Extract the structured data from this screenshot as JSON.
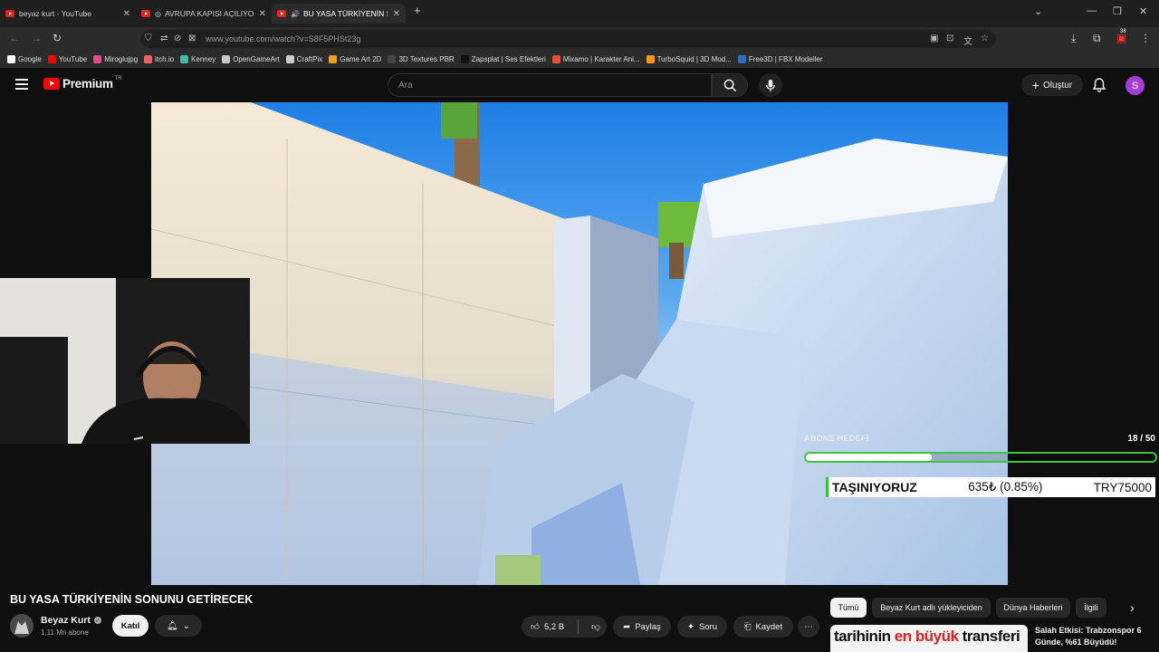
{
  "browser": {
    "tabs": [
      {
        "label": "beyaz kurt - YouTube"
      },
      {
        "label": "AVRUPA KAPISI AÇILIYOR: E"
      },
      {
        "label": "BU YASA TÜRKİYENİN SONU"
      }
    ],
    "url": "www.youtube.com/watch?v=S8F5PHSt23g",
    "extension_badge": "38",
    "bookmarks": [
      {
        "label": "Google",
        "color": "#ffffff"
      },
      {
        "label": "YouTube",
        "color": "#ff0000"
      },
      {
        "label": "Miroglujpg",
        "color": "#e84a8a"
      },
      {
        "label": "itch.io",
        "color": "#fa5c5c"
      },
      {
        "label": "Kenney",
        "color": "#3cbfa3"
      },
      {
        "label": "OpenGameArt",
        "color": "#c7c7c7"
      },
      {
        "label": "CraftPix",
        "color": "#cccccc"
      },
      {
        "label": "Game Art 2D",
        "color": "#f2a30f"
      },
      {
        "label": "3D Textures PBR",
        "color": "#444444"
      },
      {
        "label": "Zapsplat | Ses Efektleri",
        "color": "#111111"
      },
      {
        "label": "Mixamo | Karakter Ani...",
        "color": "#e0533a"
      },
      {
        "label": "TurboSquid | 3D Mod...",
        "color": "#f29a1d"
      },
      {
        "label": "Free3D | FBX Modeller",
        "color": "#2c6cc9"
      }
    ]
  },
  "yt_header": {
    "logo": "Premium",
    "country": "TR",
    "search_placeholder": "Ara",
    "create_label": "Oluştur",
    "avatar_letter": "S",
    "avatar_color": "#a43ed6"
  },
  "overlay": {
    "goal_label": "ABONE HEDEFİ",
    "goal_count": "18 / 50",
    "goal_progress": 0.36,
    "ticker_left": "TAŞINIYORUZ",
    "ticker_mid": "635₺ (0.85%)",
    "ticker_right": "TRY75000"
  },
  "video": {
    "title": "BU YASA TÜRKİYENİN SONUNU GETİRECEK",
    "channel": "Beyaz Kurt",
    "subscribers": "1,11 Mn abone",
    "join_label": "Katıl",
    "like_count": "5,2 B",
    "share_label": "Paylaş",
    "ask_label": "Soru",
    "save_label": "Kaydet"
  },
  "chips": [
    "Tümü",
    "Beyaz Kurt adlı yükleyiciden",
    "Dünya Haberleri",
    "İlgili"
  ],
  "recommendation": {
    "thumb_text_pre": "tarihinin",
    "thumb_text_hl": "en büyük",
    "thumb_text_post": "transferi",
    "title": "Salah Etkisi: Trabzonspor 6 Günde, %61 Büyüdü!"
  }
}
